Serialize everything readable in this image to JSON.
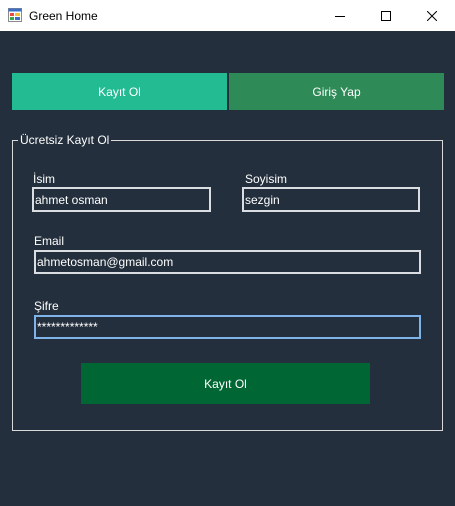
{
  "window": {
    "title": "Green Home"
  },
  "tabs": {
    "register_label": "Kayıt Ol",
    "login_label": "Giriş Yap"
  },
  "form": {
    "legend": "Ücretsiz Kayıt Ol",
    "name": {
      "label": "İsim",
      "value": "ahmet osman"
    },
    "surname": {
      "label": "Soyisim",
      "value": "sezgin"
    },
    "email": {
      "label": "Email",
      "value": "ahmetosman@gmail.com"
    },
    "password": {
      "label": "Şifre",
      "masked_value": "*************"
    },
    "submit_label": "Kayıt Ol"
  },
  "colors": {
    "background": "#232f3c",
    "register_tab": "#22bb92",
    "login_tab": "#2e8b57",
    "submit_button": "#006633",
    "focused_border": "#7eb4ea"
  },
  "icons": {
    "app": "app-window-icon",
    "minimize": "minimize-icon",
    "maximize": "maximize-icon",
    "close": "close-icon"
  }
}
